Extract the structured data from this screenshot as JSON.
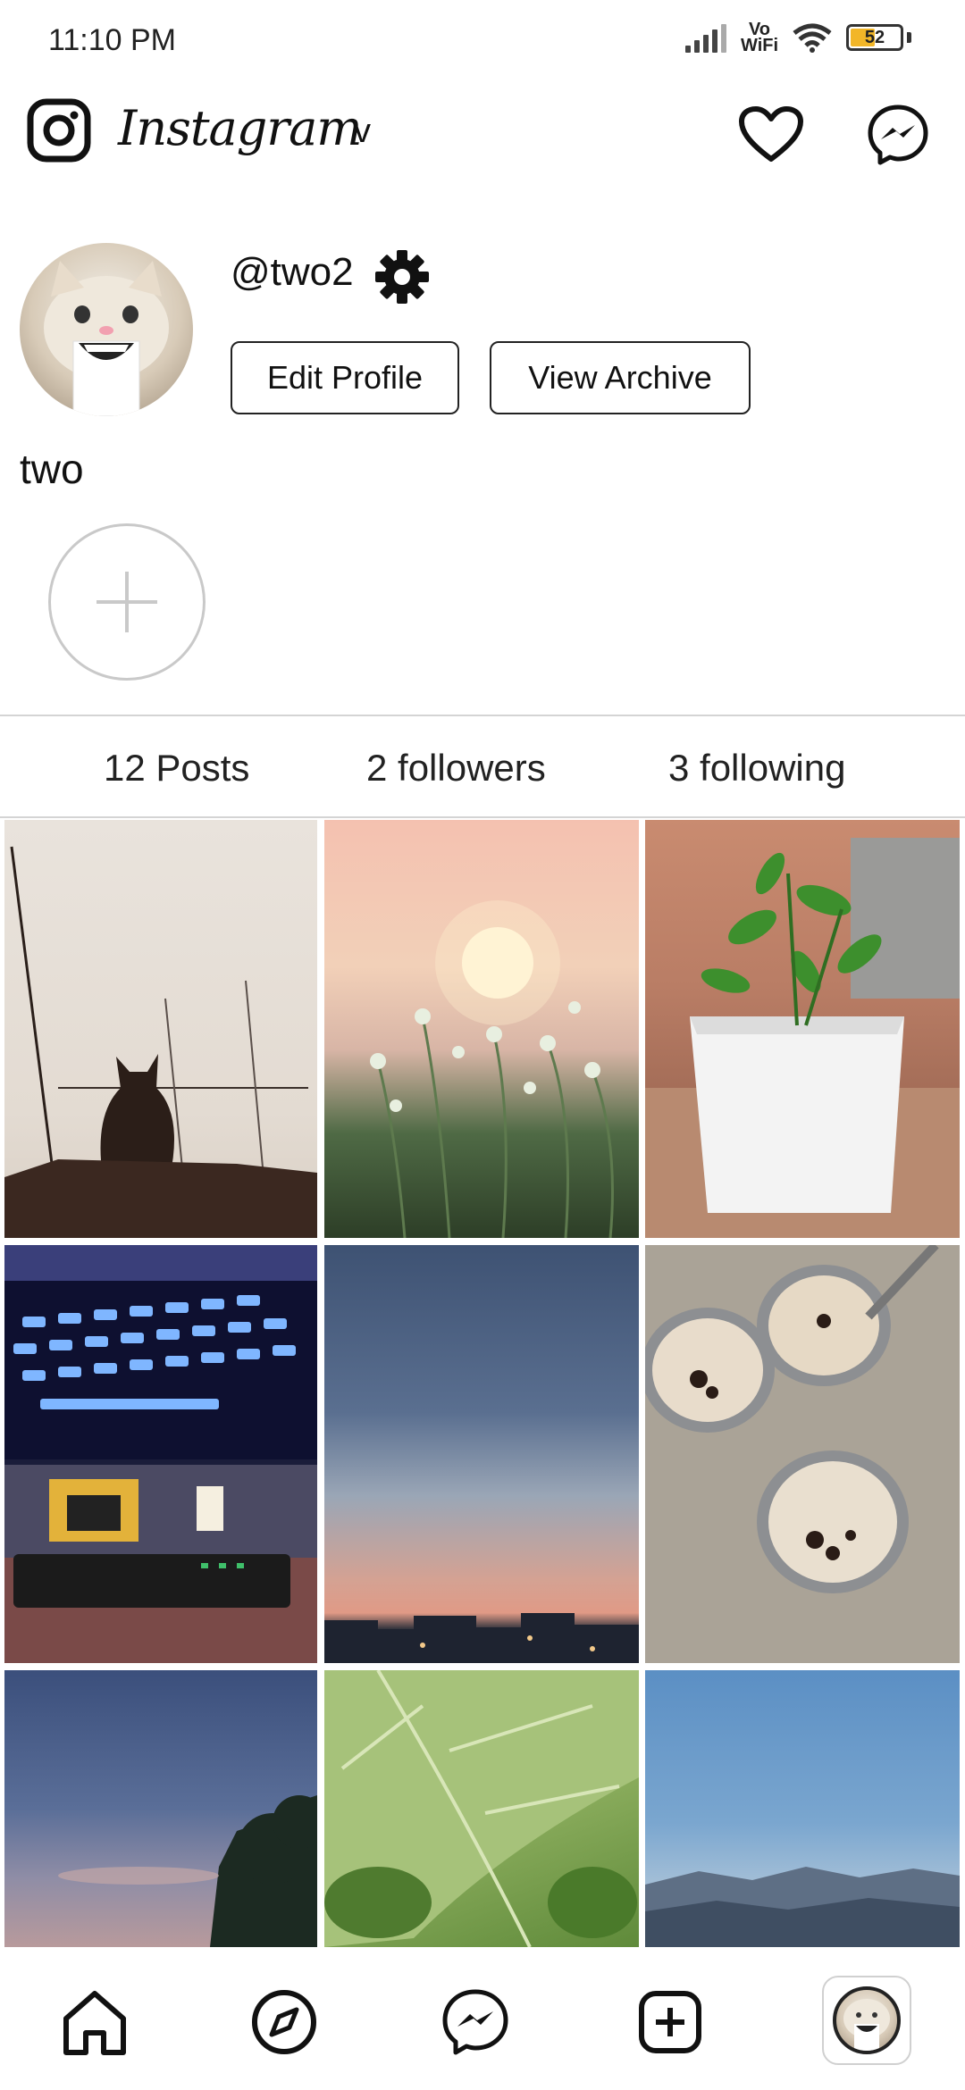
{
  "status_bar": {
    "time": "11:10 PM",
    "network_label": "Vo WiFi",
    "battery_level": "52"
  },
  "header": {
    "title": "Instagram",
    "account_switch_glyph": "v",
    "icons": [
      "instagram-logo-icon",
      "heart-icon",
      "messenger-icon"
    ]
  },
  "profile": {
    "username": "@two2",
    "display_name": "two",
    "edit_button": "Edit Profile",
    "archive_button": "View Archive"
  },
  "stats": {
    "posts": "12 Posts",
    "followers": "2 followers",
    "following": "3 following"
  },
  "grid": {
    "photos": [
      "cat silhouette on wall",
      "sunset over wildflowers",
      "potted plant by brick wall",
      "backlit keyboard and desk setup",
      "dusk sky over city",
      "three cups of cold coffee",
      "evening sky with tree",
      "green leaf close-up",
      "blue sky over hills"
    ]
  },
  "bottom_nav": {
    "items": [
      "home-icon",
      "explore-compass-icon",
      "messenger-icon",
      "add-post-icon",
      "profile-avatar"
    ]
  },
  "colors": {
    "background": "#ffffff",
    "text": "#111111",
    "divider": "#d4d4d4",
    "battery_fill": "#f2b628"
  }
}
